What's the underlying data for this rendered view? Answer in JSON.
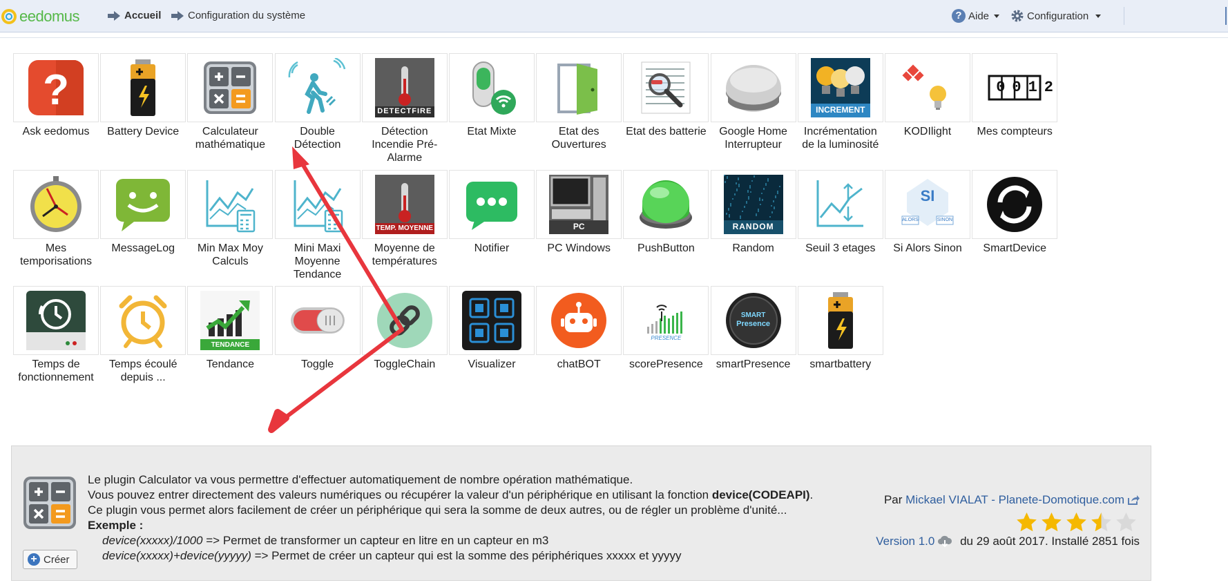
{
  "header": {
    "logo_text": "eedomus",
    "breadcrumb_home": "Accueil",
    "breadcrumb_config": "Configuration du système",
    "help_label": "Aide",
    "config_label": "Configuration"
  },
  "plugins": [
    {
      "label": "Ask eedomus",
      "icon": "question-mark-icon"
    },
    {
      "label": "Battery Device",
      "icon": "battery-icon"
    },
    {
      "label": "Calculateur mathématique",
      "icon": "calculator-icon"
    },
    {
      "label": "Double Détection",
      "icon": "person-walking-icon"
    },
    {
      "label": "Détection Incendie Pré-Alarme",
      "icon": "thermometer-detectfire-icon",
      "badge": "DETECTFIRE"
    },
    {
      "label": "Etat Mixte",
      "icon": "switch-wifi-icon"
    },
    {
      "label": "Etat des Ouvertures",
      "icon": "door-icon"
    },
    {
      "label": "Etat des batterie",
      "icon": "magnifier-list-icon"
    },
    {
      "label": "Google Home Interrupteur",
      "icon": "google-home-icon"
    },
    {
      "label": "Incrémentation de la luminosité",
      "icon": "bulbs-increment-icon",
      "badge": "INCREMENT"
    },
    {
      "label": "KODIlight",
      "icon": "kodi-bulb-icon"
    },
    {
      "label": "Mes compteurs",
      "icon": "counter-icon",
      "badge": "0012"
    },
    {
      "label": "Mes temporisations",
      "icon": "stopwatch-icon"
    },
    {
      "label": "MessageLog",
      "icon": "message-smiley-icon"
    },
    {
      "label": "Min Max Moy Calculs",
      "icon": "chart-calculator-icon"
    },
    {
      "label": "Mini Maxi Moyenne Tendance",
      "icon": "chart-calculator-icon-2"
    },
    {
      "label": "Moyenne de températures",
      "icon": "thermometer-average-icon",
      "badge": "TEMP. MOYENNE"
    },
    {
      "label": "Notifier",
      "icon": "chat-bubble-icon"
    },
    {
      "label": "PC Windows",
      "icon": "pc-icon",
      "badge": "PC"
    },
    {
      "label": "PushButton",
      "icon": "green-button-icon"
    },
    {
      "label": "Random",
      "icon": "random-icon",
      "badge": "RANDOM"
    },
    {
      "label": "Seuil 3 etages",
      "icon": "threshold-chart-icon"
    },
    {
      "label": "Si Alors Sinon",
      "icon": "if-then-else-icon",
      "badge": "SI",
      "badge2": "ALORS",
      "badge3": "SINON"
    },
    {
      "label": "SmartDevice",
      "icon": "sync-circle-icon"
    },
    {
      "label": "Temps de fonctionnement",
      "icon": "clock-history-icon"
    },
    {
      "label": "Temps écoulé depuis ...",
      "icon": "alarm-clock-icon"
    },
    {
      "label": "Tendance",
      "icon": "trend-chart-icon",
      "badge": "TENDANCE"
    },
    {
      "label": "Toggle",
      "icon": "toggle-switch-icon"
    },
    {
      "label": "ToggleChain",
      "icon": "chain-link-icon"
    },
    {
      "label": "Visualizer",
      "icon": "visualizer-grid-icon"
    },
    {
      "label": "chatBOT",
      "icon": "robot-icon"
    },
    {
      "label": "scorePresence",
      "icon": "signal-bars-icon",
      "badge": "PRESENCE"
    },
    {
      "label": "smartPresence",
      "icon": "smart-presence-icon",
      "badge": "SMART",
      "badge2": "Presence"
    },
    {
      "label": "smartbattery",
      "icon": "battery-icon-2"
    }
  ],
  "description": {
    "line1": "Le plugin Calculator va vous permettre d'effectuer automatiquement de nombre opération mathématique.",
    "line2_a": "Vous pouvez entrer directement des valeurs numériques ou récupérer la valeur d'un périphérique en utilisant la fonction ",
    "line2_b": "device(CODEAPI)",
    "line2_c": ".",
    "line3": "Ce plugin vous permet alors facilement de créer un périphérique qui sera la somme de deux autres, ou de régler un problème d'unité...",
    "example_title": "Exemple :",
    "ex1_code": "device(xxxxx)/1000",
    "ex1_text": " => Permet de transformer un capteur en litre en un capteur en m3",
    "ex2_code": "device(xxxxx)+device(yyyyy)",
    "ex2_text": " => Permet de créer un capteur qui est la somme des périphériques xxxxx et yyyyy",
    "create_label": "Créer",
    "author_prefix": "Par ",
    "author_name": "Mickael VIALAT - Planete-Domotique.com",
    "rating": 3.5,
    "rating_max": 5,
    "version_label": "Version 1.0",
    "version_rest": " du 29 août 2017. Installé 2851 fois"
  },
  "colors": {
    "accent_link": "#2f5e9e",
    "annotation_arrow": "#e8363d",
    "star": "#f5b800"
  }
}
